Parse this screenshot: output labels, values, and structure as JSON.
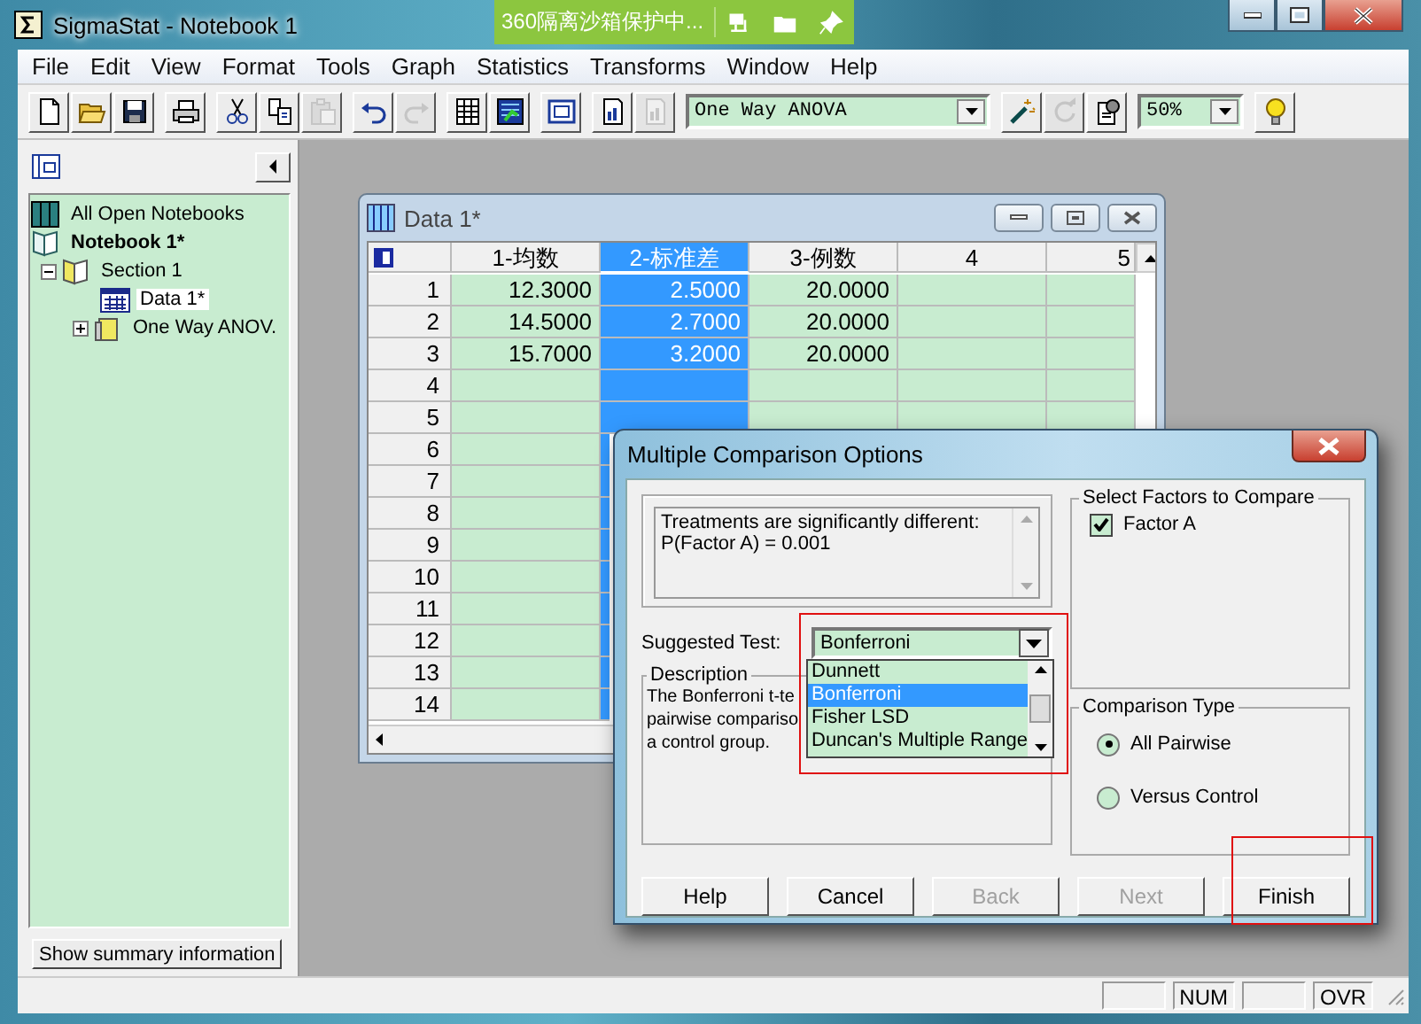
{
  "window": {
    "title": "SigmaStat - Notebook 1"
  },
  "sandbox_banner": {
    "text": "360隔离沙箱保护中..."
  },
  "menu": [
    "File",
    "Edit",
    "View",
    "Format",
    "Tools",
    "Graph",
    "Statistics",
    "Transforms",
    "Window",
    "Help"
  ],
  "toolbar": [
    [
      {
        "kind": "new",
        "disabled": false
      },
      {
        "kind": "open",
        "disabled": false
      },
      {
        "kind": "save",
        "disabled": false
      }
    ],
    [
      {
        "kind": "print",
        "disabled": false
      }
    ],
    [
      {
        "kind": "cut",
        "disabled": false
      },
      {
        "kind": "copy",
        "disabled": false
      },
      {
        "kind": "paste",
        "disabled": true
      }
    ],
    [
      {
        "kind": "undo",
        "disabled": false
      },
      {
        "kind": "redo",
        "disabled": true
      }
    ],
    [
      {
        "kind": "worksheet",
        "disabled": false
      },
      {
        "kind": "graph",
        "disabled": false
      }
    ],
    [
      {
        "kind": "window",
        "disabled": false
      }
    ],
    [
      {
        "kind": "report",
        "disabled": false
      },
      {
        "kind": "report",
        "disabled": true
      }
    ],
    [
      {
        "kind": "test_select",
        "value": "One Way ANOVA"
      }
    ],
    [
      {
        "kind": "wizard",
        "disabled": false
      },
      {
        "kind": "refresh",
        "disabled": true
      },
      {
        "kind": "options",
        "disabled": false
      }
    ],
    [
      {
        "kind": "zoom_select",
        "value": "50%"
      }
    ],
    [
      {
        "kind": "hint",
        "disabled": false
      }
    ]
  ],
  "sidebar": {
    "tree": [
      {
        "label": "All Open Notebooks",
        "kind": "root",
        "selected": false,
        "children": [
          {
            "label": "Notebook 1*",
            "kind": "notebook",
            "selected": false,
            "children": [
              {
                "label": "Section 1",
                "kind": "section",
                "expanded": true,
                "selected": false,
                "children": [
                  {
                    "label": "Data 1*",
                    "kind": "worksheet",
                    "selected": true
                  },
                  {
                    "label": "One Way ANOV.",
                    "kind": "report",
                    "expanded": false,
                    "selected": false
                  }
                ]
              }
            ]
          }
        ]
      }
    ],
    "summary_button": "Show summary information"
  },
  "data_window": {
    "title": "Data 1*",
    "columns": [
      {
        "label": "1-均数",
        "selected": false
      },
      {
        "label": "2-标准差",
        "selected": true
      },
      {
        "label": "3-例数",
        "selected": false
      },
      {
        "label": "4",
        "selected": false
      },
      {
        "label": "5",
        "selected": false
      }
    ],
    "rows": [
      {
        "number": "1",
        "cells": [
          "12.3000",
          "2.5000",
          "20.0000"
        ]
      },
      {
        "number": "2",
        "cells": [
          "14.5000",
          "2.7000",
          "20.0000"
        ]
      },
      {
        "number": "3",
        "cells": [
          "15.7000",
          "3.2000",
          "20.0000"
        ]
      },
      {
        "number": "4"
      },
      {
        "number": "5"
      },
      {
        "number": "6"
      },
      {
        "number": "7"
      },
      {
        "number": "8"
      },
      {
        "number": "9"
      },
      {
        "number": "10"
      },
      {
        "number": "11"
      },
      {
        "number": "12"
      },
      {
        "number": "13"
      },
      {
        "number": "14"
      }
    ]
  },
  "dialog": {
    "title": "Multiple Comparison Options",
    "result_lines": [
      "Treatments are significantly different:",
      "P(Factor A) = 0.001"
    ],
    "suggested_test": {
      "label": "Suggested Test:",
      "value": "Bonferroni",
      "options": [
        {
          "label": "Dunnett",
          "selected": false
        },
        {
          "label": "Bonferroni",
          "selected": true
        },
        {
          "label": "Fisher LSD",
          "selected": false
        },
        {
          "label": "Duncan's Multiple Range",
          "selected": false
        }
      ]
    },
    "description": {
      "title": "Description",
      "lines": [
        "The Bonferroni t-te",
        "pairwise compariso",
        "a control group."
      ]
    },
    "factors": {
      "title": "Select Factors to Compare",
      "items": [
        {
          "label": "Factor A",
          "checked": true
        }
      ]
    },
    "comparison_type": {
      "title": "Comparison Type",
      "options": [
        {
          "label": "All Pairwise",
          "selected": true
        },
        {
          "label": "Versus Control",
          "selected": false
        }
      ]
    },
    "buttons": [
      {
        "label": "Help",
        "disabled": false
      },
      {
        "label": "Cancel",
        "disabled": false
      },
      {
        "label": "Back",
        "disabled": true
      },
      {
        "label": "Next",
        "disabled": true
      },
      {
        "label": "Finish",
        "disabled": false
      }
    ]
  },
  "status_bar": {
    "panes": [
      {
        "kind": "blank"
      },
      {
        "kind": "indicator",
        "text": "NUM"
      },
      {
        "kind": "blank"
      },
      {
        "kind": "indicator",
        "text": "OVR"
      }
    ]
  }
}
